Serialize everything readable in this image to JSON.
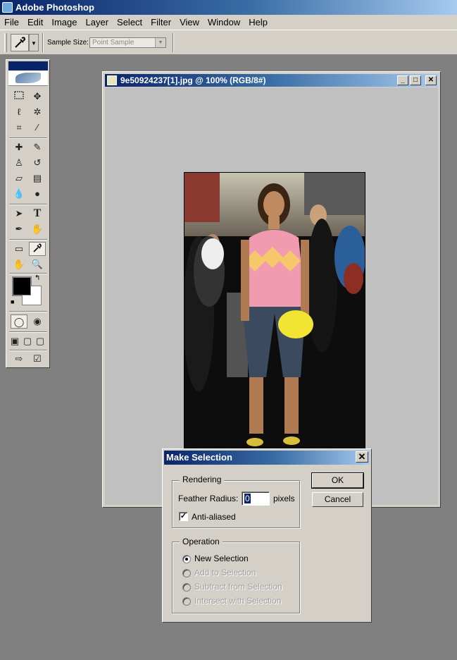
{
  "app": {
    "title": "Adobe Photoshop"
  },
  "menu": [
    "File",
    "Edit",
    "Image",
    "Layer",
    "Select",
    "Filter",
    "View",
    "Window",
    "Help"
  ],
  "options": {
    "sample_size_label": "Sample Size:",
    "sample_size_value": "Point Sample"
  },
  "document": {
    "title": "9e50924237[1].jpg @ 100% (RGB/8#)"
  },
  "window_buttons": {
    "minimize": "_",
    "maximize": "□",
    "close": "✕"
  },
  "dialog": {
    "title": "Make Selection",
    "close": "✕",
    "rendering_label": "Rendering",
    "feather_label": "Feather Radius:",
    "feather_value": "0",
    "feather_unit": "pixels",
    "anti_aliased_label": "Anti-aliased",
    "anti_aliased_checked": true,
    "operation_label": "Operation",
    "operations": [
      {
        "label": "New Selection",
        "selected": true,
        "enabled": true
      },
      {
        "label": "Add to Selection",
        "selected": false,
        "enabled": false
      },
      {
        "label": "Subtract from Selection",
        "selected": false,
        "enabled": false
      },
      {
        "label": "Intersect with Selection",
        "selected": false,
        "enabled": false
      }
    ],
    "ok_label": "OK",
    "cancel_label": "Cancel"
  },
  "colors": {
    "foreground": "#000000",
    "background": "#ffffff",
    "titlebar": "#0a246a"
  }
}
